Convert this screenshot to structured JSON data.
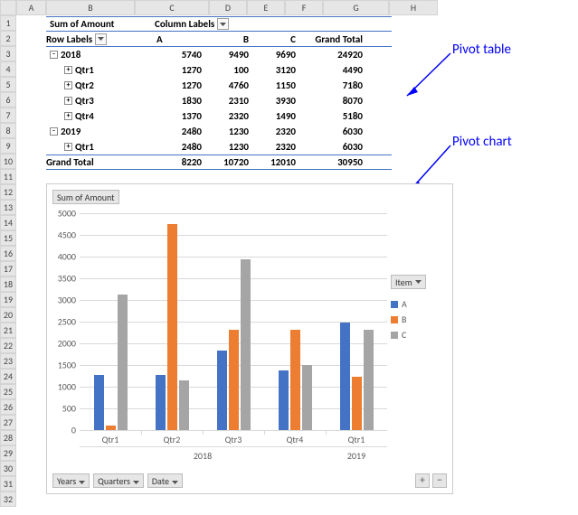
{
  "columns": [
    "A",
    "B",
    "C",
    "D",
    "E",
    "F",
    "G",
    "H"
  ],
  "rows_count": 32,
  "pivot": {
    "measure_label": "Sum of Amount",
    "col_labels_label": "Column Labels",
    "row_labels_label": "Row Labels",
    "col_headers": [
      "A",
      "B",
      "C"
    ],
    "grand_total_label": "Grand Total",
    "rows": [
      {
        "level": 0,
        "expand": "-",
        "label": "2018",
        "vals": [
          5740,
          9490,
          9690
        ],
        "gt": 24920,
        "bold": true
      },
      {
        "level": 1,
        "expand": "+",
        "label": "Qtr1",
        "vals": [
          1270,
          100,
          3120
        ],
        "gt": 4490,
        "bold": true
      },
      {
        "level": 1,
        "expand": "+",
        "label": "Qtr2",
        "vals": [
          1270,
          4760,
          1150
        ],
        "gt": 7180,
        "bold": true
      },
      {
        "level": 1,
        "expand": "+",
        "label": "Qtr3",
        "vals": [
          1830,
          2310,
          3930
        ],
        "gt": 8070,
        "bold": true
      },
      {
        "level": 1,
        "expand": "+",
        "label": "Qtr4",
        "vals": [
          1370,
          2320,
          1490
        ],
        "gt": 5180,
        "bold": true
      },
      {
        "level": 0,
        "expand": "-",
        "label": "2019",
        "vals": [
          2480,
          1230,
          2320
        ],
        "gt": 6030,
        "bold": true
      },
      {
        "level": 1,
        "expand": "+",
        "label": "Qtr1",
        "vals": [
          2480,
          1230,
          2320
        ],
        "gt": 6030,
        "bold": true
      }
    ],
    "grand_total_row": {
      "label": "Grand Total",
      "vals": [
        8220,
        10720,
        12010
      ],
      "gt": 30950
    }
  },
  "annotations": {
    "table": "Pivot table",
    "chart": "Pivot chart"
  },
  "chart_ui": {
    "measure_button": "Sum of Amount",
    "filter_buttons": [
      "Years",
      "Quarters",
      "Date"
    ],
    "legend_title": "Item",
    "plus": "+",
    "minus": "−"
  },
  "chart_data": {
    "type": "bar",
    "title": "",
    "xlabel": "",
    "ylabel": "",
    "ylim": [
      0,
      5000
    ],
    "y_ticks": [
      0,
      500,
      1000,
      1500,
      2000,
      2500,
      3000,
      3500,
      4000,
      4500,
      5000
    ],
    "groups": [
      {
        "name": "2018",
        "categories": [
          "Qtr1",
          "Qtr2",
          "Qtr3",
          "Qtr4"
        ]
      },
      {
        "name": "2019",
        "categories": [
          "Qtr1"
        ]
      }
    ],
    "categories": [
      "Qtr1",
      "Qtr2",
      "Qtr3",
      "Qtr4",
      "Qtr1"
    ],
    "series": [
      {
        "name": "A",
        "color": "#4472c4",
        "values": [
          1270,
          1270,
          1830,
          1370,
          2480
        ]
      },
      {
        "name": "B",
        "color": "#ed7d31",
        "values": [
          100,
          4760,
          2310,
          2320,
          1230
        ]
      },
      {
        "name": "C",
        "color": "#a5a5a5",
        "values": [
          3120,
          1150,
          3930,
          1490,
          2320
        ]
      }
    ]
  }
}
